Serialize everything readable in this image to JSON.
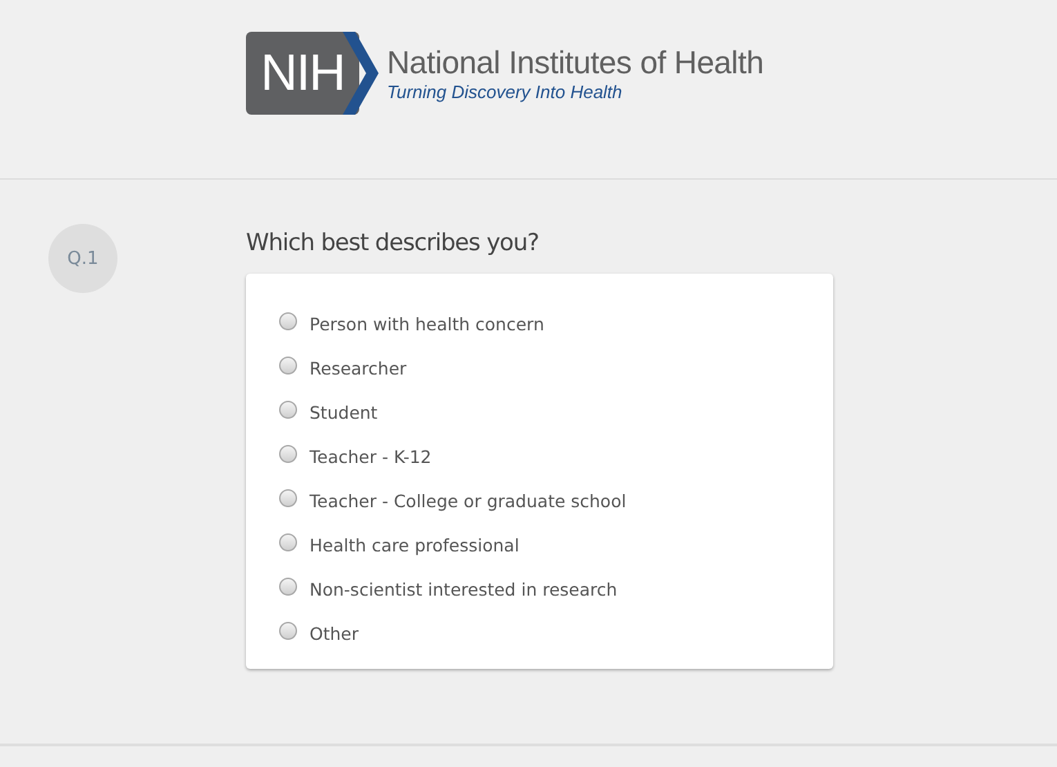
{
  "header": {
    "logo_mark": "NIH",
    "title": "National Institutes of Health",
    "tagline": "Turning Discovery Into Health"
  },
  "question": {
    "number": "Q.1",
    "text": "Which best describes you?",
    "options": [
      {
        "label": "Person with health concern",
        "selected": false
      },
      {
        "label": "Researcher",
        "selected": false
      },
      {
        "label": "Student",
        "selected": false
      },
      {
        "label": "Teacher - K-12",
        "selected": false
      },
      {
        "label": "Teacher - College or graduate school",
        "selected": false
      },
      {
        "label": "Health care professional",
        "selected": false
      },
      {
        "label": "Non-scientist interested in research",
        "selected": false
      },
      {
        "label": "Other",
        "selected": false
      }
    ]
  }
}
